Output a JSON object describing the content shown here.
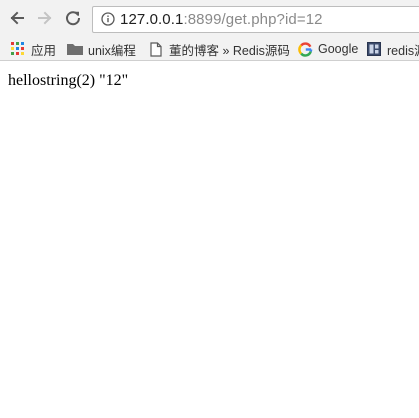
{
  "address_bar": {
    "host": "127.0.0.1",
    "rest": ":8899/get.php?id=12"
  },
  "bookmarks": [
    {
      "label": "应用",
      "icon": "apps-grid-icon"
    },
    {
      "label": "unix编程",
      "icon": "folder-icon"
    },
    {
      "label": "董的博客 » Redis源码",
      "icon": "page-icon"
    },
    {
      "label": "Google",
      "icon": "google-g-icon"
    },
    {
      "label": "redis源",
      "icon": "bookmark-site-icon"
    }
  ],
  "page": {
    "output": "hellostring(2) \"12\""
  },
  "colors": {
    "toolbar_bg": "#f2f2f2",
    "url_host": "#202020",
    "url_rest": "#8a8a8a"
  }
}
